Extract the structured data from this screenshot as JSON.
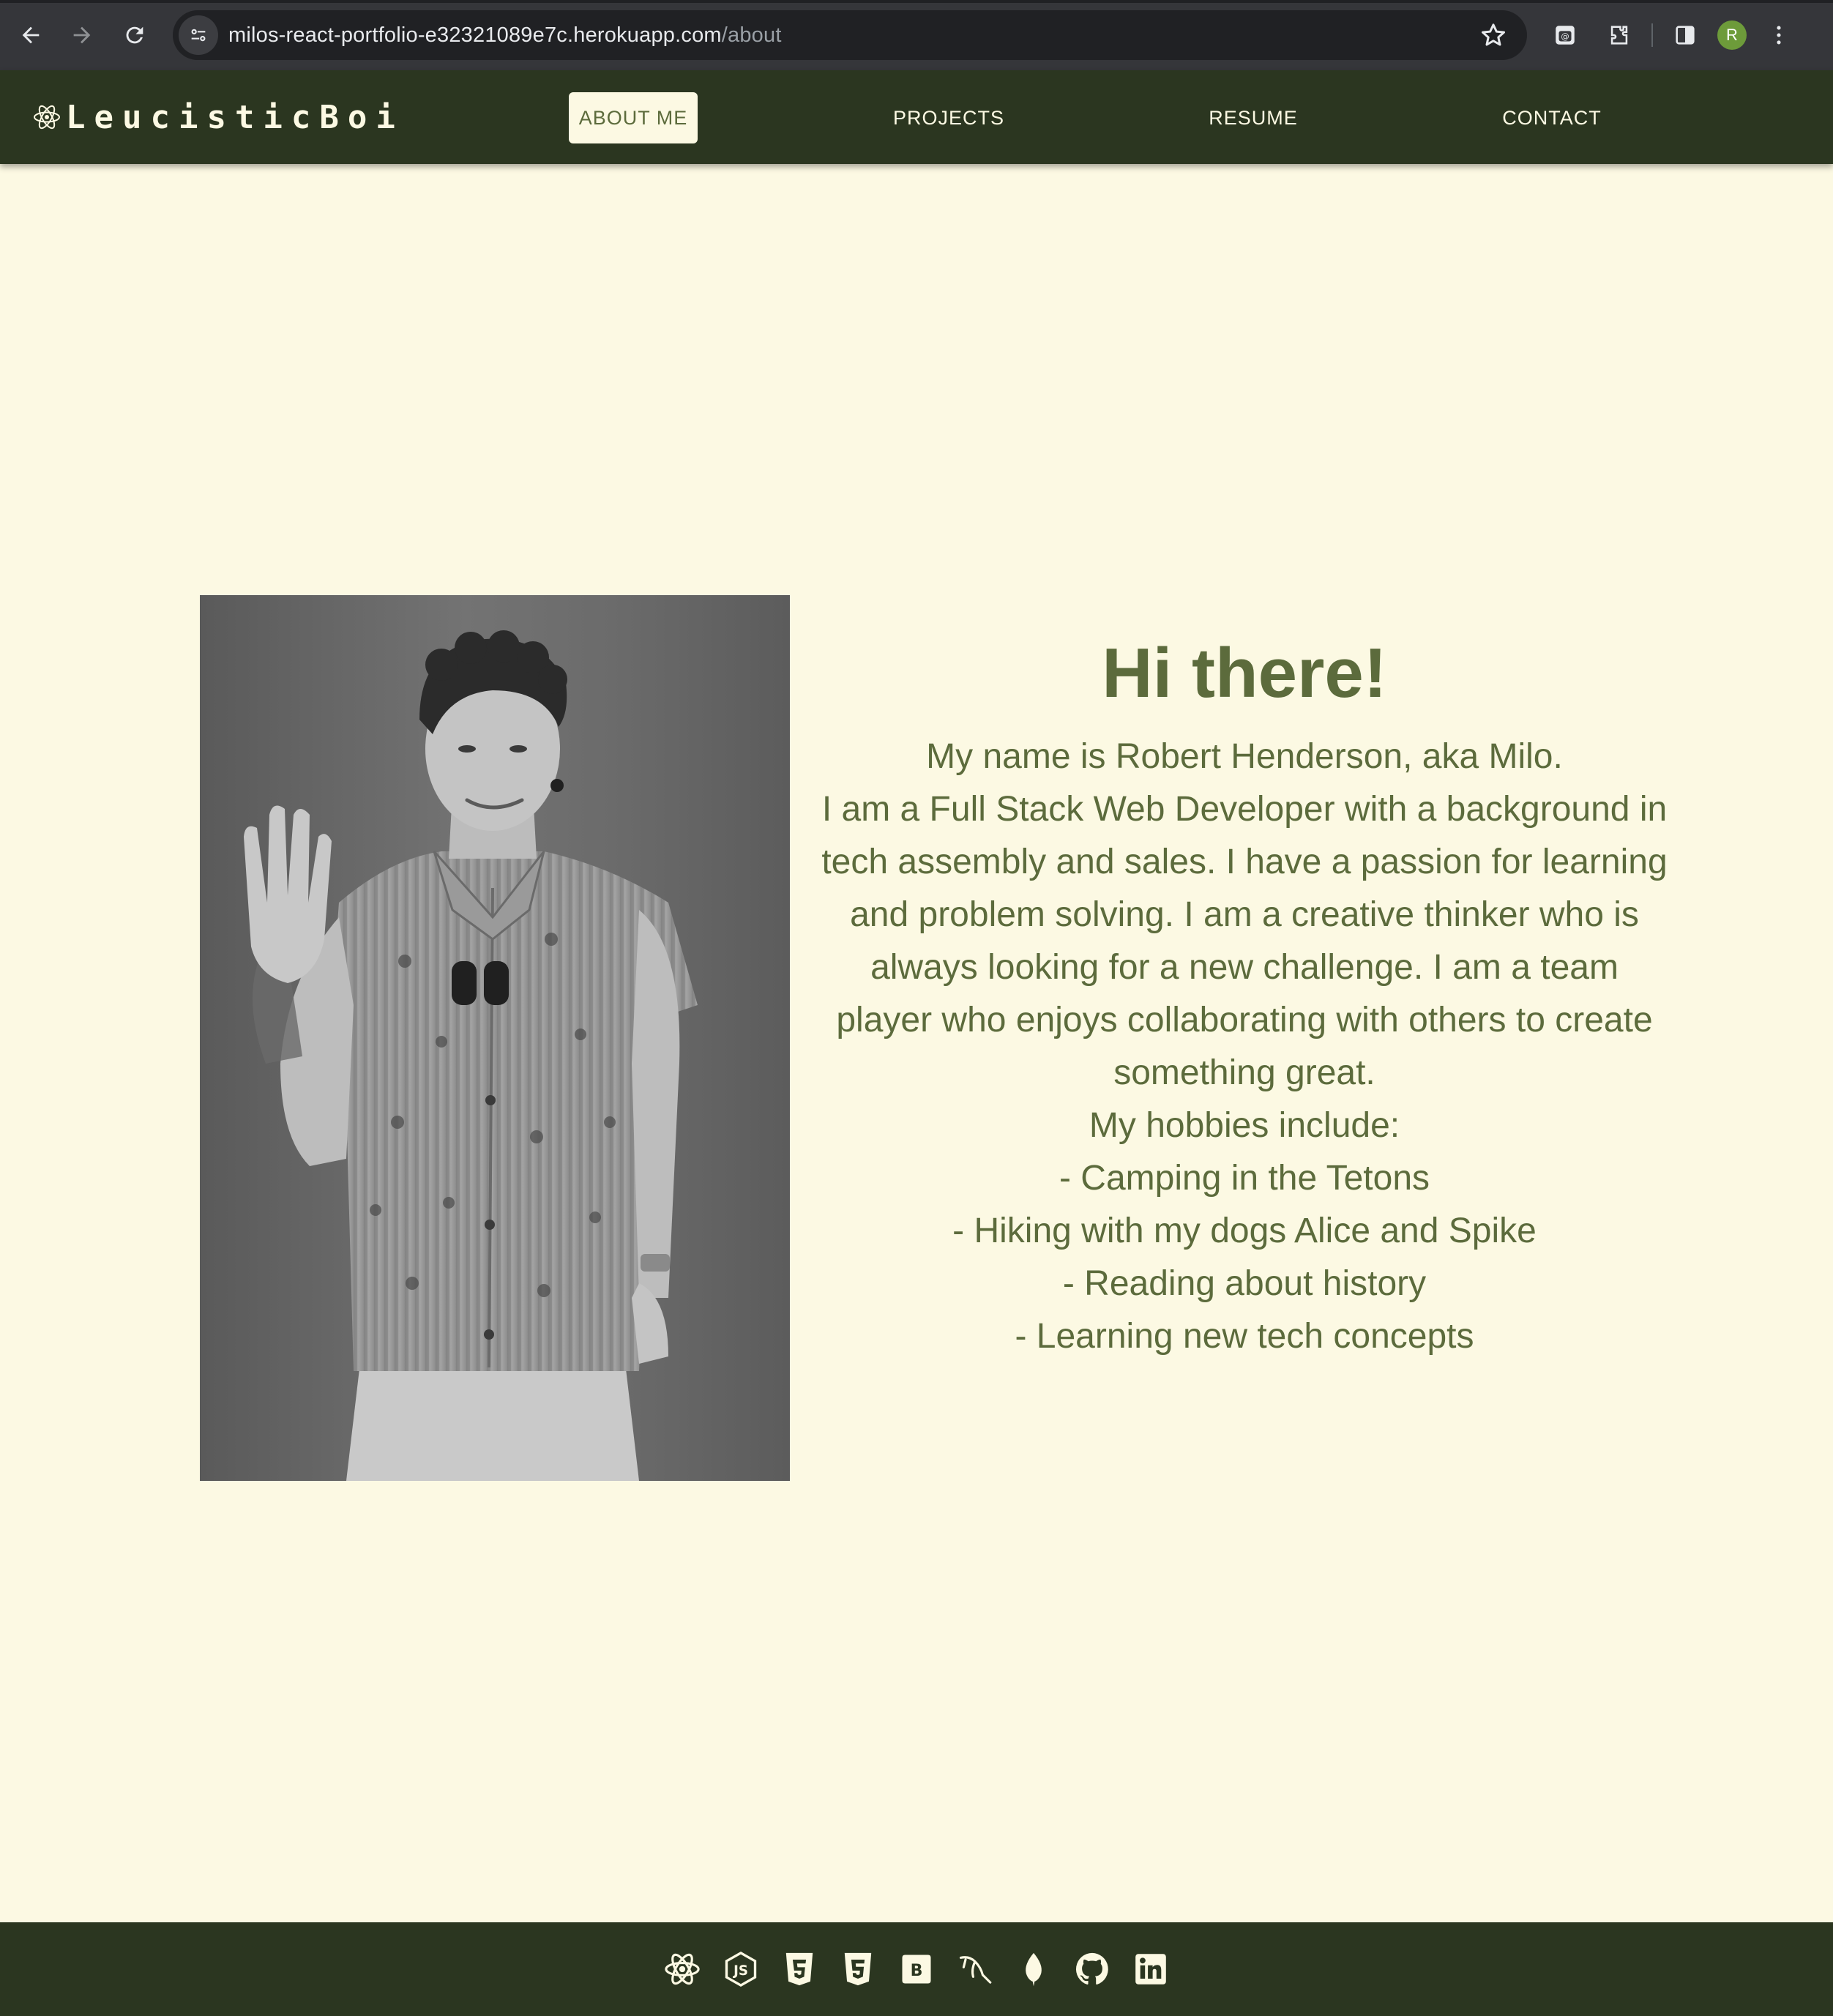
{
  "browser": {
    "url_host": "milos-react-portfolio-e32321089e7c.herokuapp.com",
    "url_path": "/about",
    "profile_initial": "R",
    "icons": [
      "back-icon",
      "forward-icon",
      "reload-icon",
      "site-info-icon",
      "bookmark-star-icon",
      "password-manager-icon",
      "extensions-icon",
      "side-panel-icon",
      "more-menu-icon"
    ]
  },
  "site": {
    "brand": "LeucisticBoi",
    "brand_icon": "react-atom-icon",
    "nav": [
      {
        "label": "ABOUT ME",
        "active": true
      },
      {
        "label": "PROJECTS",
        "active": false
      },
      {
        "label": "RESUME",
        "active": false
      },
      {
        "label": "CONTACT",
        "active": false
      }
    ]
  },
  "about": {
    "heading": "Hi there!",
    "bio_lines": [
      "My name is Robert Henderson, aka Milo.",
      "I am a Full Stack Web Developer with a background in tech assembly and sales. I have a passion for learning and problem solving. I am a creative thinker who is always looking for a new challenge. I am a team player who enjoys collaborating with others to create something great.",
      "My hobbies include:"
    ],
    "hobbies": [
      "- Camping in the Tetons",
      "- Hiking with my dogs Alice and Spike",
      "- Reading about history",
      "- Learning new tech concepts"
    ],
    "photo": "portrait-photo"
  },
  "footer": {
    "icons": [
      "react-icon",
      "nodejs-icon",
      "html5-icon",
      "css3-icon",
      "bootstrap-icon",
      "mysql-icon",
      "mongodb-icon",
      "github-icon",
      "linkedin-icon"
    ]
  },
  "colors": {
    "nav_bg": "#2b3620",
    "page_bg": "#fcf9e3",
    "text": "#5c6b3c",
    "chrome_bg": "#35363a"
  }
}
